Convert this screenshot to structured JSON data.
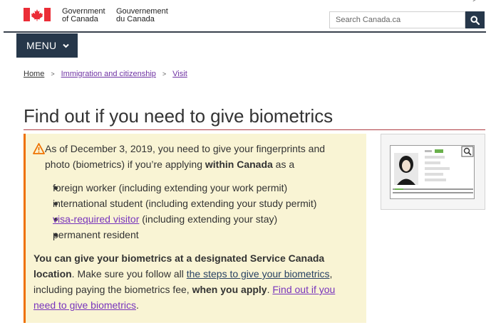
{
  "header": {
    "gov_en_line1": "Government",
    "gov_en_line2": "of Canada",
    "gov_fr_line1": "Gouvernement",
    "gov_fr_line2": "du Canada",
    "search_placeholder": "Search Canada.ca",
    "menu_label": "MENU"
  },
  "breadcrumb": [
    {
      "label": "Home"
    },
    {
      "label": "Immigration and citizenship"
    },
    {
      "label": "Visit"
    }
  ],
  "page_title": "Find out if you need to give biometrics",
  "alert": {
    "intro_1": "As of December 3, 2019, you need to give your fingerprints and",
    "intro_2a": "photo (biometrics) if you’re applying ",
    "intro_2b": "within Canada",
    "intro_2c": " as a",
    "bullets": [
      {
        "text": "foreign worker (including extending your work permit)"
      },
      {
        "text": "international student (including extending your study permit)"
      },
      {
        "link": "visa-required visitor",
        "text": " (including extending your stay)"
      },
      {
        "text": "permanent resident"
      }
    ],
    "para_1": "You can give your biometrics at a designated Service Canada",
    "para_2a": "location",
    "para_2b": ". Make sure you follow all ",
    "para_2c": "the steps to give your biometrics",
    "para_2d": ",",
    "para_3a": "including paying the biometrics fee, ",
    "para_3b": "when you apply",
    "para_3c": ". ",
    "para_3d": "Find out if you",
    "para_4a": "need to give biometrics",
    "para_4b": "."
  },
  "colors": {
    "header_navy": "#26374a",
    "title_rule": "#af3c43",
    "alert_bg": "#f9f4d4",
    "alert_border": "#ee7100",
    "flag_red": "#eb2d37"
  },
  "icons": [
    "canada-flag-icon",
    "search-icon",
    "chevron-down-icon",
    "warning-icon",
    "id-card-icon"
  ]
}
